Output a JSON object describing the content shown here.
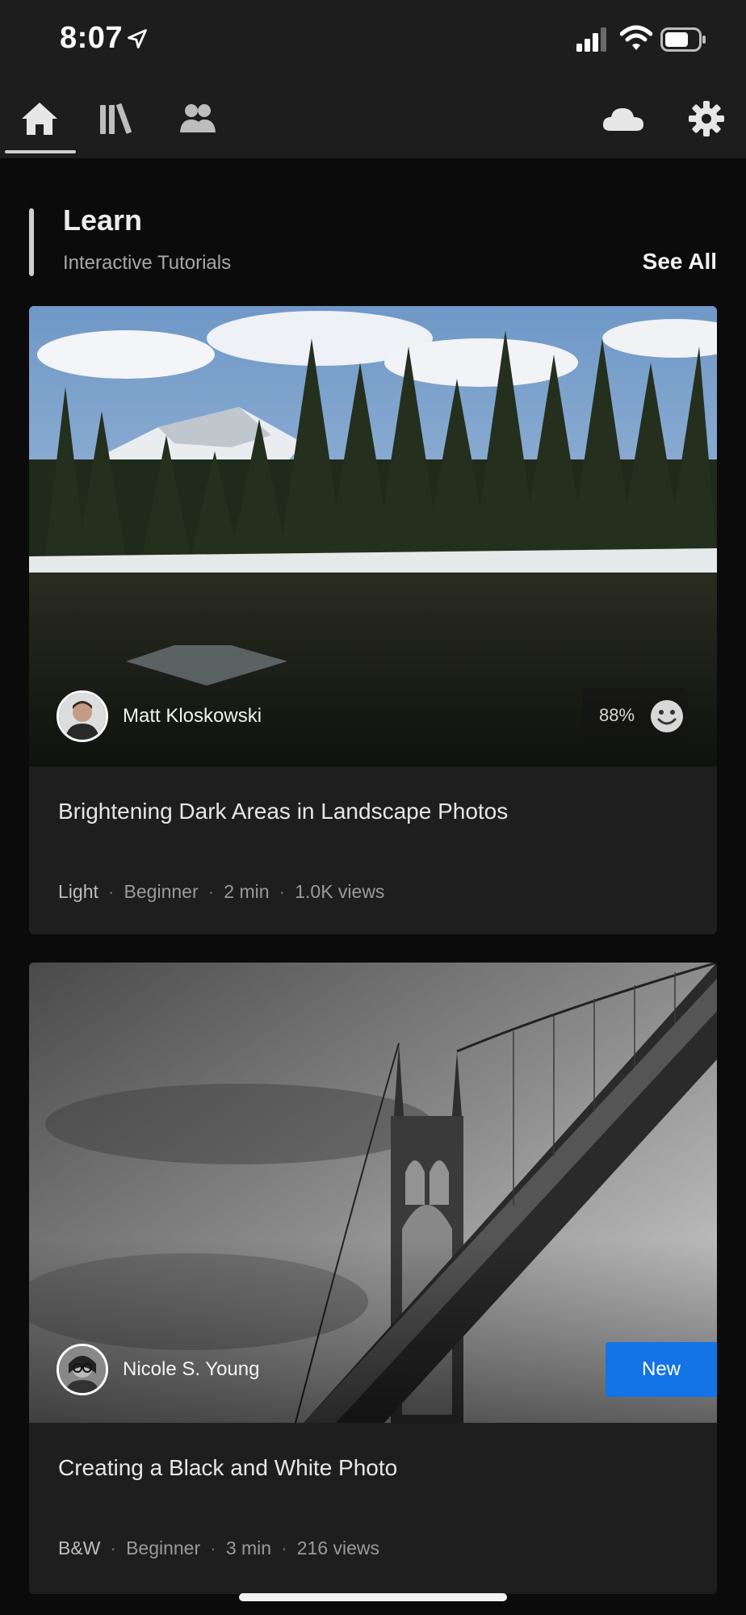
{
  "status_bar": {
    "time": "8:07"
  },
  "nav": {
    "icons": [
      "home-icon",
      "library-icon",
      "people-icon",
      "cloud-icon",
      "gear-icon"
    ],
    "active": "home"
  },
  "section": {
    "title": "Learn",
    "subtitle": "Interactive Tutorials",
    "see_all": "See All"
  },
  "cards": [
    {
      "author": "Matt Kloskowski",
      "rating": "88%",
      "title": "Brightening Dark Areas in Landscape Photos",
      "meta": [
        "Light",
        "Beginner",
        "2 min",
        "1.0K views"
      ]
    },
    {
      "author": "Nicole S. Young",
      "badge": "New",
      "title": "Creating a Black and White Photo",
      "meta": [
        "B&W",
        "Beginner",
        "3 min",
        "216 views"
      ]
    }
  ],
  "colors": {
    "accent": "#1473e6",
    "background": "#0b0b0b",
    "card": "#1e1e1e"
  }
}
